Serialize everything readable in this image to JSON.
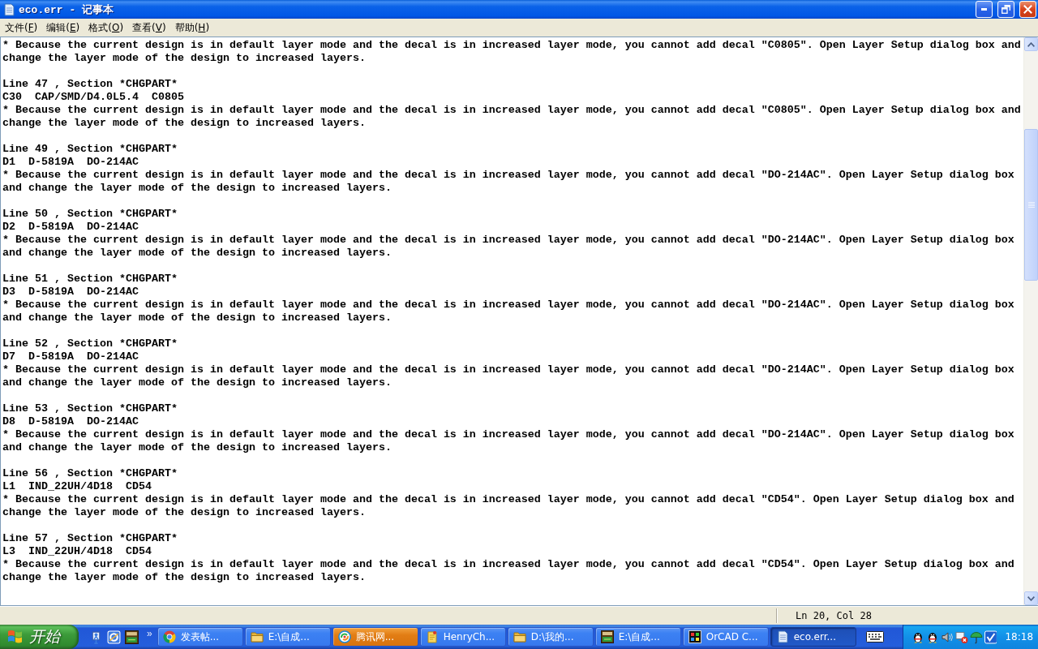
{
  "window": {
    "title": "eco.err - 记事本"
  },
  "menu": [
    "文件(F)",
    "编辑(E)",
    "格式(O)",
    "查看(V)",
    "帮助(H)"
  ],
  "document": {
    "lead_message": "* Because the current design is in default layer mode and the decal is in increased layer mode, you cannot add decal \"C0805\". Open Layer Setup dialog box and change the layer mode of the design to increased layers.",
    "entries": [
      {
        "header": "Line 47 , Section *CHGPART*",
        "part": "C30  CAP/SMD/D4.0L5.4  C0805",
        "message": "* Because the current design is in default layer mode and the decal is in increased layer mode, you cannot add decal \"C0805\". Open Layer Setup dialog box and change the layer mode of the design to increased layers."
      },
      {
        "header": "Line 49 , Section *CHGPART*",
        "part": "D1  D-5819A  DO-214AC",
        "message": "* Because the current design is in default layer mode and the decal is in increased layer mode, you cannot add decal \"DO-214AC\". Open Layer Setup dialog box and change the layer mode of the design to increased layers."
      },
      {
        "header": "Line 50 , Section *CHGPART*",
        "part": "D2  D-5819A  DO-214AC",
        "message": "* Because the current design is in default layer mode and the decal is in increased layer mode, you cannot add decal \"DO-214AC\". Open Layer Setup dialog box and change the layer mode of the design to increased layers."
      },
      {
        "header": "Line 51 , Section *CHGPART*",
        "part": "D3  D-5819A  DO-214AC",
        "message": "* Because the current design is in default layer mode and the decal is in increased layer mode, you cannot add decal \"DO-214AC\". Open Layer Setup dialog box and change the layer mode of the design to increased layers."
      },
      {
        "header": "Line 52 , Section *CHGPART*",
        "part": "D7  D-5819A  DO-214AC",
        "message": "* Because the current design is in default layer mode and the decal is in increased layer mode, you cannot add decal \"DO-214AC\". Open Layer Setup dialog box and change the layer mode of the design to increased layers."
      },
      {
        "header": "Line 53 , Section *CHGPART*",
        "part": "D8  D-5819A  DO-214AC",
        "message": "* Because the current design is in default layer mode and the decal is in increased layer mode, you cannot add decal \"DO-214AC\". Open Layer Setup dialog box and change the layer mode of the design to increased layers."
      },
      {
        "header": "Line 56 , Section *CHGPART*",
        "part": "L1  IND_22UH/4D18  CD54",
        "message": "* Because the current design is in default layer mode and the decal is in increased layer mode, you cannot add decal \"CD54\". Open Layer Setup dialog box and change the layer mode of the design to increased layers."
      },
      {
        "header": "Line 57 , Section *CHGPART*",
        "part": "L3  IND_22UH/4D18  CD54",
        "message": "* Because the current design is in default layer mode and the decal is in increased layer mode, you cannot add decal \"CD54\". Open Layer Setup dialog box and change the layer mode of the design to increased layers."
      }
    ]
  },
  "status_bar": {
    "position": "Ln 20, Col 28"
  },
  "taskbar": {
    "start": "开始",
    "more": "»",
    "tasks": [
      {
        "label": "发表帖...",
        "kind": "color-wheel",
        "selected": false,
        "flashing": false
      },
      {
        "label": "E:\\自成...",
        "kind": "folder",
        "selected": false,
        "flashing": false
      },
      {
        "label": "腾讯网...",
        "kind": "swirl",
        "selected": false,
        "flashing": true
      },
      {
        "label": "HenryCh...",
        "kind": "note",
        "selected": false,
        "flashing": false
      },
      {
        "label": "D:\\我的...",
        "kind": "folder",
        "selected": false,
        "flashing": false
      },
      {
        "label": "E:\\自成...",
        "kind": "board",
        "selected": false,
        "flashing": false
      },
      {
        "label": "OrCAD C...",
        "kind": "app-tile",
        "selected": false,
        "flashing": false
      },
      {
        "label": "eco.err...",
        "kind": "notepad",
        "selected": true,
        "flashing": false
      }
    ],
    "clock": "18:18"
  }
}
